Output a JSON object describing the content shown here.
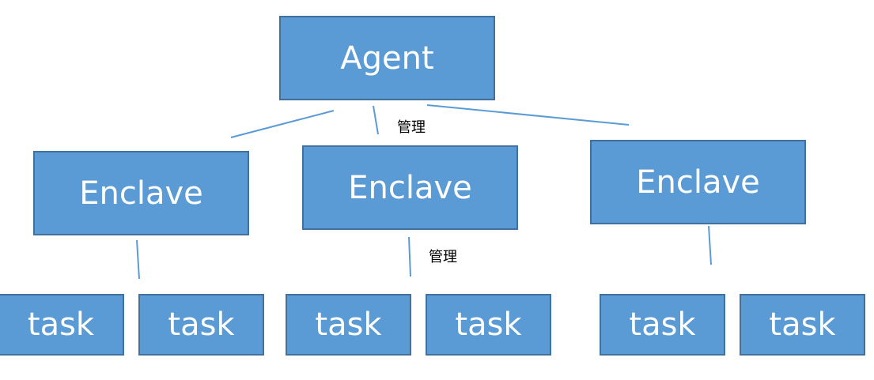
{
  "agent": {
    "label": "Agent"
  },
  "edge_labels": [
    "管理",
    "管理"
  ],
  "enclaves": [
    {
      "label": "Enclave",
      "tasks": [
        "task",
        "task"
      ]
    },
    {
      "label": "Enclave",
      "tasks": [
        "task",
        "task"
      ]
    },
    {
      "label": "Enclave",
      "tasks": [
        "task",
        "task"
      ]
    }
  ],
  "colors": {
    "box_fill": "#5b9bd5",
    "box_border": "#41719c",
    "line": "#5b9bd5",
    "text": "#ffffff"
  }
}
